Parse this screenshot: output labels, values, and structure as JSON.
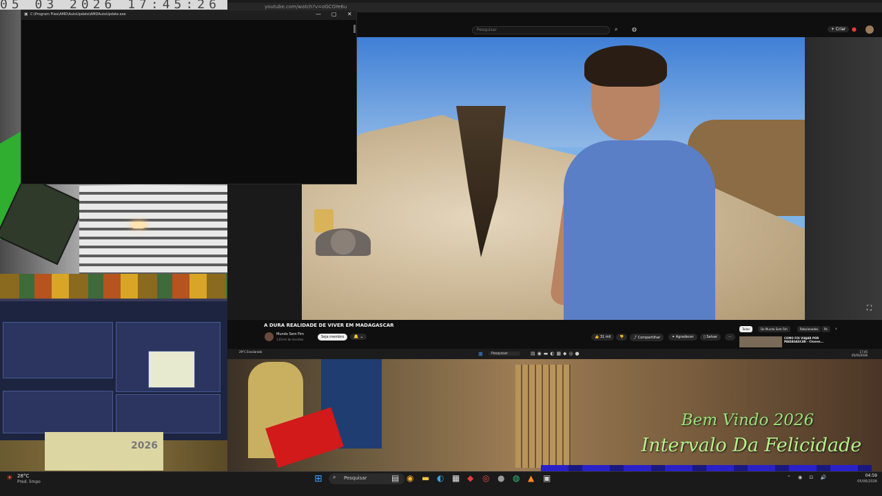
{
  "overlay": {
    "clock_stripe": "05 03 2026 17:45:26",
    "welcome": "Bem Vindo 2026",
    "subtitle": "Intervalo Da Felicidade",
    "calendar_year": "2026"
  },
  "console": {
    "title": "C:\\Program Files\\AMD\\AutoUpdate\\AMDAutoUpdate.exe"
  },
  "browser": {
    "url": "youtube.com/watch?v=oGCGYe6u",
    "search_placeholder": "Pesquisar",
    "create_label": "+ Criar",
    "video": {
      "title": "A DURA REALIDADE DE VIVER EM MADAGASCAR",
      "channel": "Mundo Sem Fim",
      "subscribers": "1,03 mi de inscritos",
      "join_label": "Seja membro",
      "bell_label": "🔔 ⌄",
      "like_label": "👍 31 mil",
      "dislike_label": "👎",
      "share_label": "⤴ Compartilhar",
      "thanks_label": "✦ Agradecer",
      "save_label": "▯ Salvar",
      "more_label": "···"
    },
    "chips": [
      "Todos",
      "Do Mundo Sem Fim",
      "Relacionados",
      "Pa"
    ],
    "recommended": {
      "title": "COMO FOI VIAJAR POR MADAGASCAR - Chaves..."
    }
  },
  "inner_taskbar": {
    "weather": "29°C Ensolarado",
    "search": "Pesquisar",
    "time": "17:45",
    "date": "05/03/2026"
  },
  "taskbar": {
    "weather_temp": "28°C",
    "weather_desc": "Pred. limpo",
    "search_placeholder": "Pesquisar",
    "apps": [
      {
        "icon": "file-explorer-icon",
        "glyph": "▤",
        "color": "#dddddd"
      },
      {
        "icon": "chrome-icon",
        "glyph": "◉",
        "color": "#f2b233"
      },
      {
        "icon": "folder-icon",
        "glyph": "▬",
        "color": "#f5c542"
      },
      {
        "icon": "edge-icon",
        "glyph": "◐",
        "color": "#32a8e8"
      },
      {
        "icon": "store-icon",
        "glyph": "▦",
        "color": "#e6e6e6"
      },
      {
        "icon": "app-red-icon",
        "glyph": "◆",
        "color": "#e63b3b"
      },
      {
        "icon": "app-red2-icon",
        "glyph": "◎",
        "color": "#e84d3d"
      },
      {
        "icon": "app-gray-icon",
        "glyph": "●",
        "color": "#9a9a9a"
      },
      {
        "icon": "app-green-icon",
        "glyph": "◍",
        "color": "#33c07a"
      },
      {
        "icon": "app-orange-icon",
        "glyph": "▲",
        "color": "#ff8c1a"
      },
      {
        "icon": "terminal-icon",
        "glyph": "▣",
        "color": "#cfcfcf"
      }
    ],
    "tray": "⌃ ◉ ⊡ 🔊",
    "time": "04:59",
    "date": "05/06/2026"
  }
}
